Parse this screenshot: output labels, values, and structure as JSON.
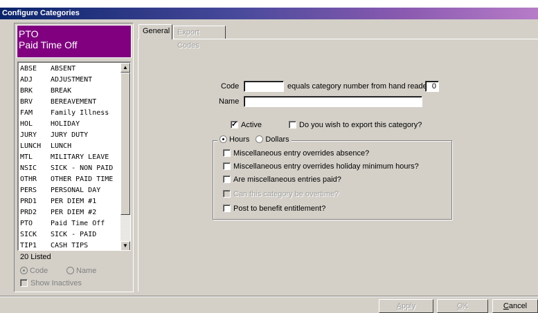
{
  "window": {
    "title": "Configure Categories"
  },
  "selected": {
    "code": "PTO",
    "name": "Paid Time Off"
  },
  "list": {
    "items": [
      {
        "code": "ABSE",
        "name": "ABSENT"
      },
      {
        "code": "ADJ",
        "name": "ADJUSTMENT"
      },
      {
        "code": "BRK",
        "name": "BREAK"
      },
      {
        "code": "BRV",
        "name": "BEREAVEMENT"
      },
      {
        "code": "FAM",
        "name": "Family Illness"
      },
      {
        "code": "HOL",
        "name": "HOLIDAY"
      },
      {
        "code": "JURY",
        "name": "JURY DUTY"
      },
      {
        "code": "LUNCH",
        "name": "LUNCH"
      },
      {
        "code": "MTL",
        "name": "MILITARY LEAVE"
      },
      {
        "code": "NSIC",
        "name": "SICK - NON PAID"
      },
      {
        "code": "OTHR",
        "name": "OTHER PAID TIME"
      },
      {
        "code": "PERS",
        "name": "PERSONAL DAY"
      },
      {
        "code": "PRD1",
        "name": "PER DIEM #1"
      },
      {
        "code": "PRD2",
        "name": "PER DIEM #2"
      },
      {
        "code": "PTO",
        "name": "Paid Time Off"
      },
      {
        "code": "SICK",
        "name": "SICK - PAID"
      },
      {
        "code": "TIP1",
        "name": "CASH TIPS"
      }
    ],
    "count_label": "20 Listed",
    "sort_code_label": "Code",
    "sort_name_label": "Name",
    "sort_selected": "Code",
    "show_inactives_label": "Show Inactives"
  },
  "tabs": [
    {
      "label": "General",
      "active": true,
      "enabled": true
    },
    {
      "label": "Export Codes",
      "active": false,
      "enabled": false
    }
  ],
  "general": {
    "code_label": "Code",
    "code_value": "",
    "equals_label": "equals category number from hand reader",
    "hand_reader_number": "0",
    "name_label": "Name",
    "name_value": "",
    "active_label": "Active",
    "active_checked": true,
    "export_label": "Do you wish to export this category?",
    "export_checked": false,
    "hours_label": "Hours",
    "dollars_label": "Dollars",
    "unit_selected": "Hours",
    "options": [
      {
        "label": "Miscellaneous entry overrides absence?",
        "checked": false,
        "enabled": true
      },
      {
        "label": "Miscellaneous entry overrides holiday minimum hours?",
        "checked": false,
        "enabled": true
      },
      {
        "label": "Are miscellaneous entries paid?",
        "checked": false,
        "enabled": true
      },
      {
        "label": "Can this category be overtime?",
        "checked": false,
        "enabled": false
      },
      {
        "label": "Post to benefit entitlement?",
        "checked": false,
        "enabled": true
      }
    ]
  },
  "buttons": {
    "apply": {
      "label": "Apply",
      "mnemonic": "A",
      "rest": "pply"
    },
    "ok": {
      "label": "OK",
      "mnemonic": "O",
      "rest": "K"
    },
    "cancel": {
      "label": "Cancel",
      "mnemonic": "C",
      "rest": "ancel"
    }
  }
}
